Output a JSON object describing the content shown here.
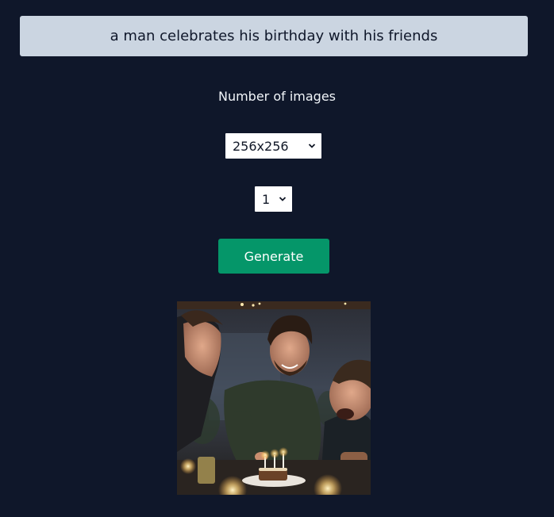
{
  "prompt": {
    "value": "a man celebrates his birthday with his friends"
  },
  "count_label": "Number of images",
  "size_select": {
    "selected": "256x256"
  },
  "count_select": {
    "selected": "1"
  },
  "generate_button": {
    "label": "Generate"
  },
  "colors": {
    "background": "#0f172a",
    "input_background": "#cbd5e1",
    "button": "#059669"
  }
}
